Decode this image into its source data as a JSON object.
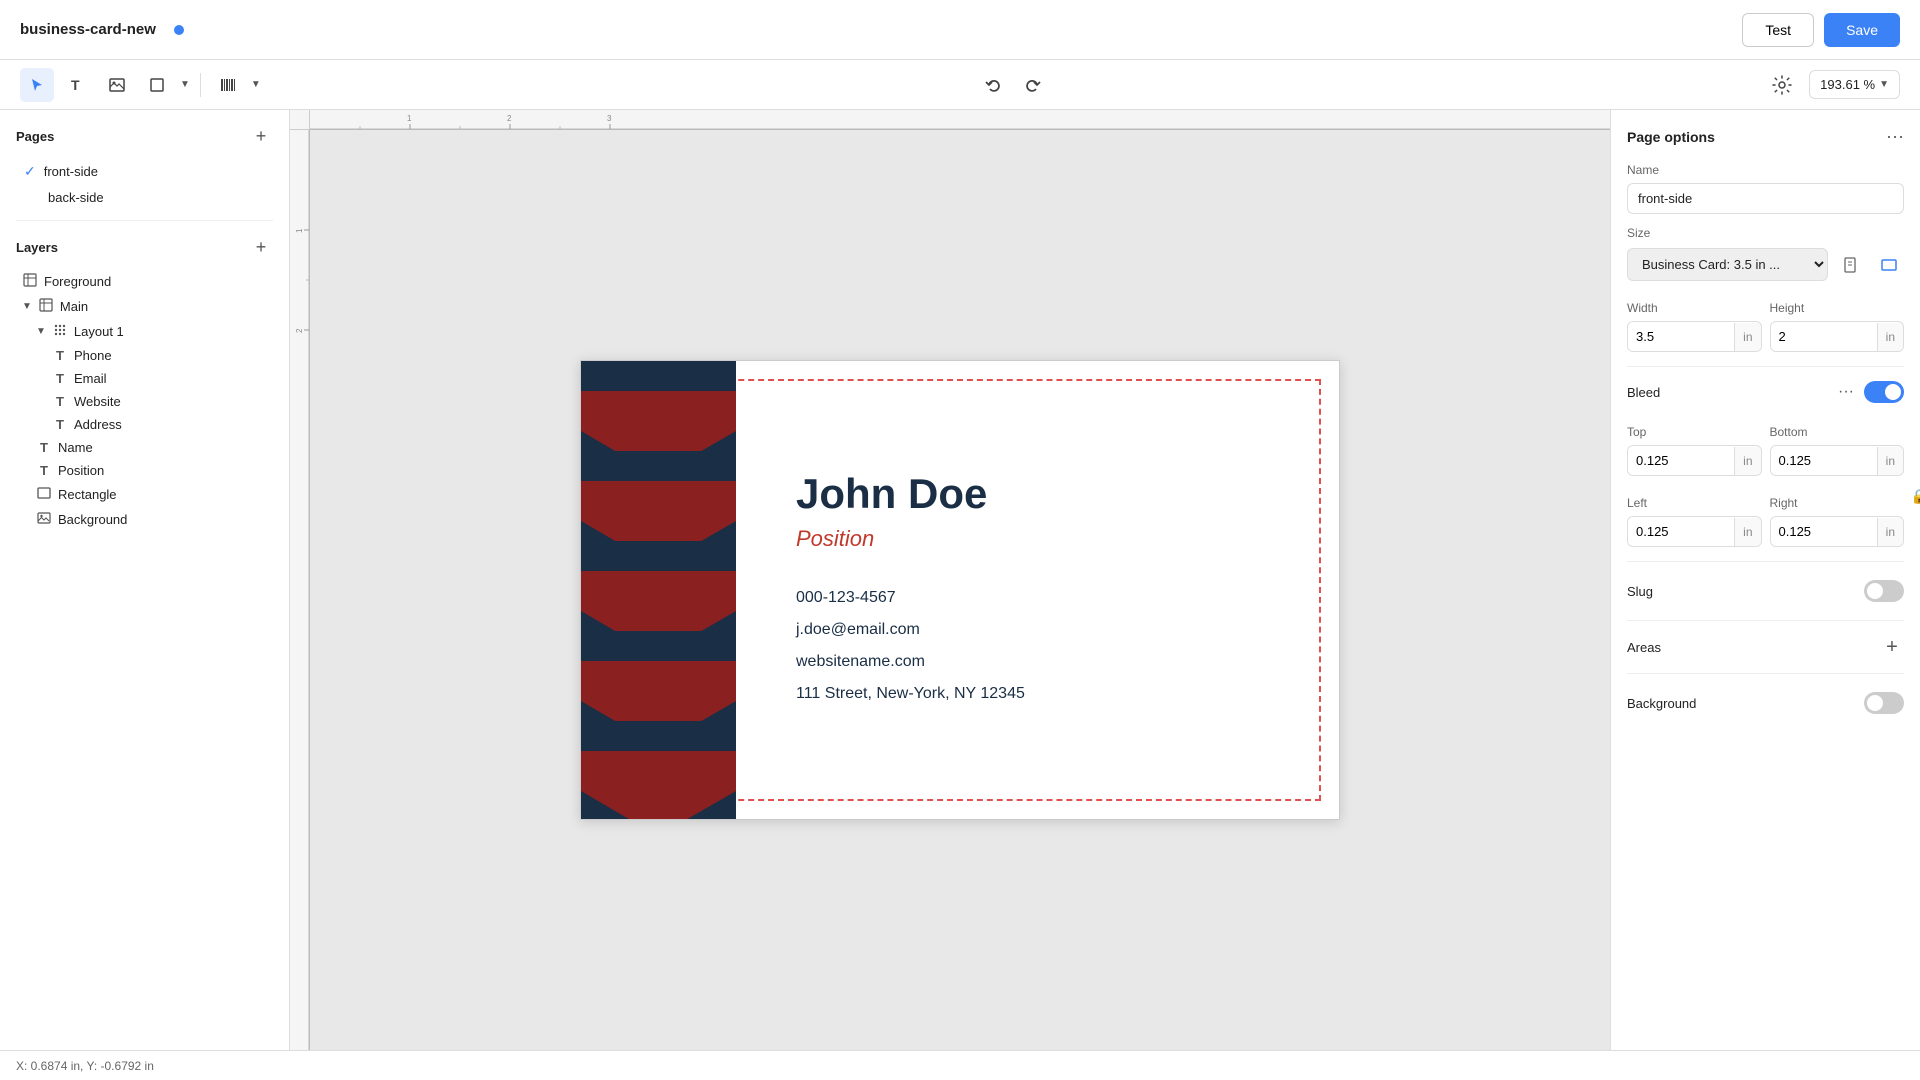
{
  "topbar": {
    "title": "business-card-new",
    "cursor_text": "▶",
    "test_label": "Test",
    "save_label": "Save"
  },
  "toolbar": {
    "zoom_label": "193.61 %",
    "undo_title": "Undo",
    "redo_title": "Redo"
  },
  "pages": {
    "title": "Pages",
    "items": [
      {
        "label": "front-side",
        "active": true
      },
      {
        "label": "back-side",
        "active": false
      }
    ]
  },
  "layers": {
    "title": "Layers",
    "items": [
      {
        "label": "Foreground",
        "indent": 0,
        "icon": "grid",
        "arrow": ""
      },
      {
        "label": "Main",
        "indent": 0,
        "icon": "grid",
        "arrow": "▼"
      },
      {
        "label": "Layout 1",
        "indent": 1,
        "icon": "dots-grid",
        "arrow": "▼"
      },
      {
        "label": "Phone",
        "indent": 2,
        "icon": "T",
        "arrow": ""
      },
      {
        "label": "Email",
        "indent": 2,
        "icon": "T",
        "arrow": ""
      },
      {
        "label": "Website",
        "indent": 2,
        "icon": "T",
        "arrow": ""
      },
      {
        "label": "Address",
        "indent": 2,
        "icon": "T",
        "arrow": ""
      },
      {
        "label": "Name",
        "indent": 1,
        "icon": "T",
        "arrow": ""
      },
      {
        "label": "Position",
        "indent": 1,
        "icon": "T",
        "arrow": ""
      },
      {
        "label": "Rectangle",
        "indent": 1,
        "icon": "rect",
        "arrow": ""
      },
      {
        "label": "Background",
        "indent": 1,
        "icon": "img",
        "arrow": ""
      }
    ]
  },
  "card": {
    "name": "John Doe",
    "position": "Position",
    "phone": "000-123-4567",
    "email": "j.doe@email.com",
    "website": "websitename.com",
    "address": "111 Street, New-York, NY 12345"
  },
  "right_panel": {
    "title": "Page options",
    "name_label": "Name",
    "name_value": "front-side",
    "size_label": "Size",
    "size_value": "Business Card: 3.5 in ...",
    "width_label": "Width",
    "width_value": "3.5",
    "height_label": "Height",
    "height_value": "2",
    "unit": "in",
    "bleed_label": "Bleed",
    "bleed_top_label": "Top",
    "bleed_top_value": "0.125",
    "bleed_bottom_label": "Bottom",
    "bleed_bottom_value": "0.125",
    "bleed_left_label": "Left",
    "bleed_left_value": "0.125",
    "bleed_right_label": "Right",
    "bleed_right_value": "0.125",
    "slug_label": "Slug",
    "areas_label": "Areas",
    "background_label": "Background"
  },
  "statusbar": {
    "coords": "X: 0.6874 in, Y: -0.6792 in"
  }
}
